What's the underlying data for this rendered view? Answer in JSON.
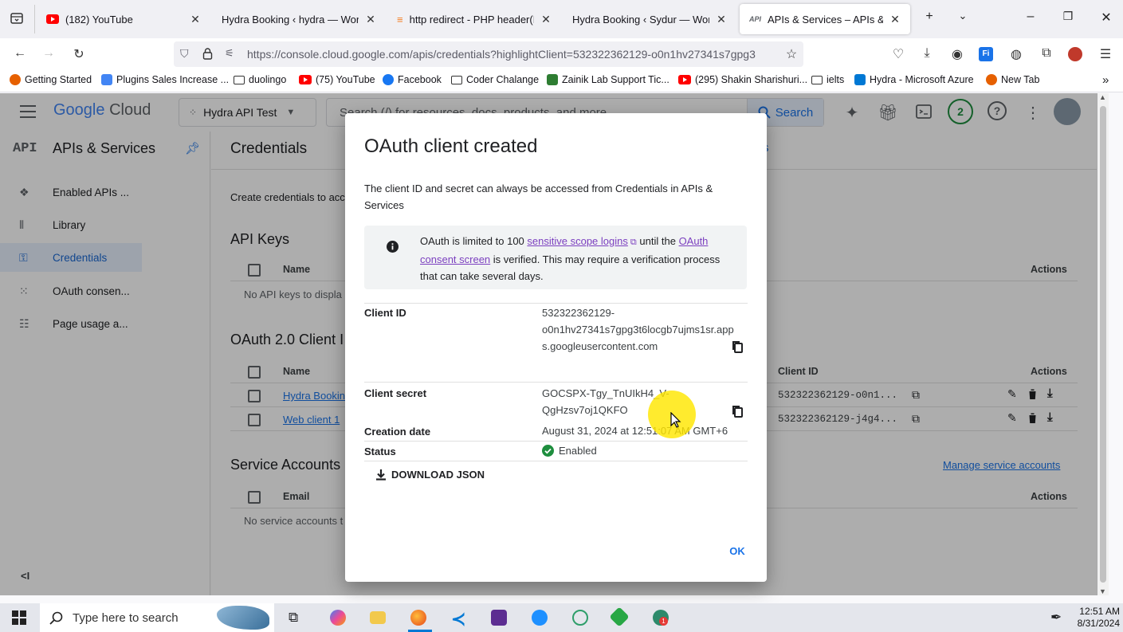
{
  "browser": {
    "tabs": [
      {
        "title": "(182) YouTube",
        "type": "youtube"
      },
      {
        "title": "Hydra Booking ‹ hydra — WordPress",
        "type": "wp"
      },
      {
        "title": "http redirect - PHP header(Location)",
        "type": "so"
      },
      {
        "title": "Hydra Booking ‹ Sydur — WordPress",
        "type": "wp"
      },
      {
        "title": "APIs & Services – APIs & Services",
        "type": "api",
        "active": true
      }
    ],
    "url": "https://console.cloud.google.com/apis/credentials?highlightClient=532322362129-o0n1hv27341s7gpg3",
    "bookmarks": [
      {
        "label": "Getting Started",
        "color": "#e66000"
      },
      {
        "label": "Plugins Sales Increase ...",
        "color": "#4285f4"
      },
      {
        "label": "duolingo",
        "color": "folder"
      },
      {
        "label": "(75) YouTube",
        "color": "#ff0000"
      },
      {
        "label": "Facebook",
        "color": "#1877f2"
      },
      {
        "label": "Coder Chalange",
        "color": "folder"
      },
      {
        "label": "Zainik Lab Support Tic...",
        "color": "#2e7d32"
      },
      {
        "label": "(295) Shakin Sharishuri...",
        "color": "#ff0000"
      },
      {
        "label": "ielts",
        "color": "folder"
      },
      {
        "label": "Hydra - Microsoft Azure",
        "color": "#0078d4"
      },
      {
        "label": "New Tab",
        "color": "#e66000"
      }
    ]
  },
  "gcp": {
    "logo_google": "Google",
    "logo_cloud": "Cloud",
    "project": "Hydra API Test",
    "search_placeholder": "Search (/) for resources, docs, products, and more",
    "search_button": "Search",
    "notif_count": "2",
    "api_logo": "API",
    "product_title": "APIs & Services",
    "nav": [
      {
        "label": "Enabled APIs ...",
        "icon": "diamond-grid-icon"
      },
      {
        "label": "Library",
        "icon": "library-icon"
      },
      {
        "label": "Credentials",
        "icon": "key-icon",
        "active": true
      },
      {
        "label": "OAuth consen...",
        "icon": "dots-icon"
      },
      {
        "label": "Page usage a...",
        "icon": "settings-list-icon"
      }
    ],
    "collapse": "<I",
    "page_title": "Credentials",
    "page_title_frag": "s",
    "intro": "Create credentials to acc",
    "api_keys": {
      "heading": "API Keys",
      "col_name": "Name",
      "col_actions": "Actions",
      "empty": "No API keys to displa"
    },
    "oauth": {
      "heading": "OAuth 2.0 Client I",
      "col_name": "Name",
      "col_client_id": "Client ID",
      "col_actions": "Actions",
      "rows": [
        {
          "name": "Hydra Bookin",
          "client_id": "532322362129-o0n1..."
        },
        {
          "name": "Web client 1",
          "client_id": "532322362129-j4g4..."
        }
      ]
    },
    "service": {
      "heading": "Service Accounts",
      "manage": "Manage service accounts",
      "col_email": "Email",
      "col_actions": "Actions",
      "empty": "No service accounts t"
    }
  },
  "dialog": {
    "title": "OAuth client created",
    "subtitle": "The client ID and secret can always be accessed from Credentials in APIs & Services",
    "notice_pre": "OAuth is limited to 100 ",
    "notice_link1": "sensitive scope logins",
    "notice_mid": " until the ",
    "notice_link2": "OAuth consent screen",
    "notice_post": " is verified. This may require a verification process that can take several days.",
    "client_id_label": "Client ID",
    "client_id_lines": [
      "532322362129-",
      "o0n1hv27341s7gpg3t6locgb7ujms1sr.app",
      "s.googleusercontent.com"
    ],
    "client_secret_label": "Client secret",
    "client_secret_lines": [
      "GOCSPX-Tgy_TnUIkH4_V-",
      "QgHzsv7oj1QKFO"
    ],
    "creation_label": "Creation date",
    "creation_value": "August 31, 2024 at 12:51:07 AM GMT+6",
    "status_label": "Status",
    "status_value": "Enabled",
    "download": "DOWNLOAD JSON",
    "ok": "OK"
  },
  "taskbar": {
    "search_placeholder": "Type here to search",
    "time": "12:51 AM",
    "date": "8/31/2024"
  },
  "colors": {
    "accent": "#1a73e8",
    "status_ok": "#1e8e3e",
    "cursor_highlight": "#ffe600"
  }
}
